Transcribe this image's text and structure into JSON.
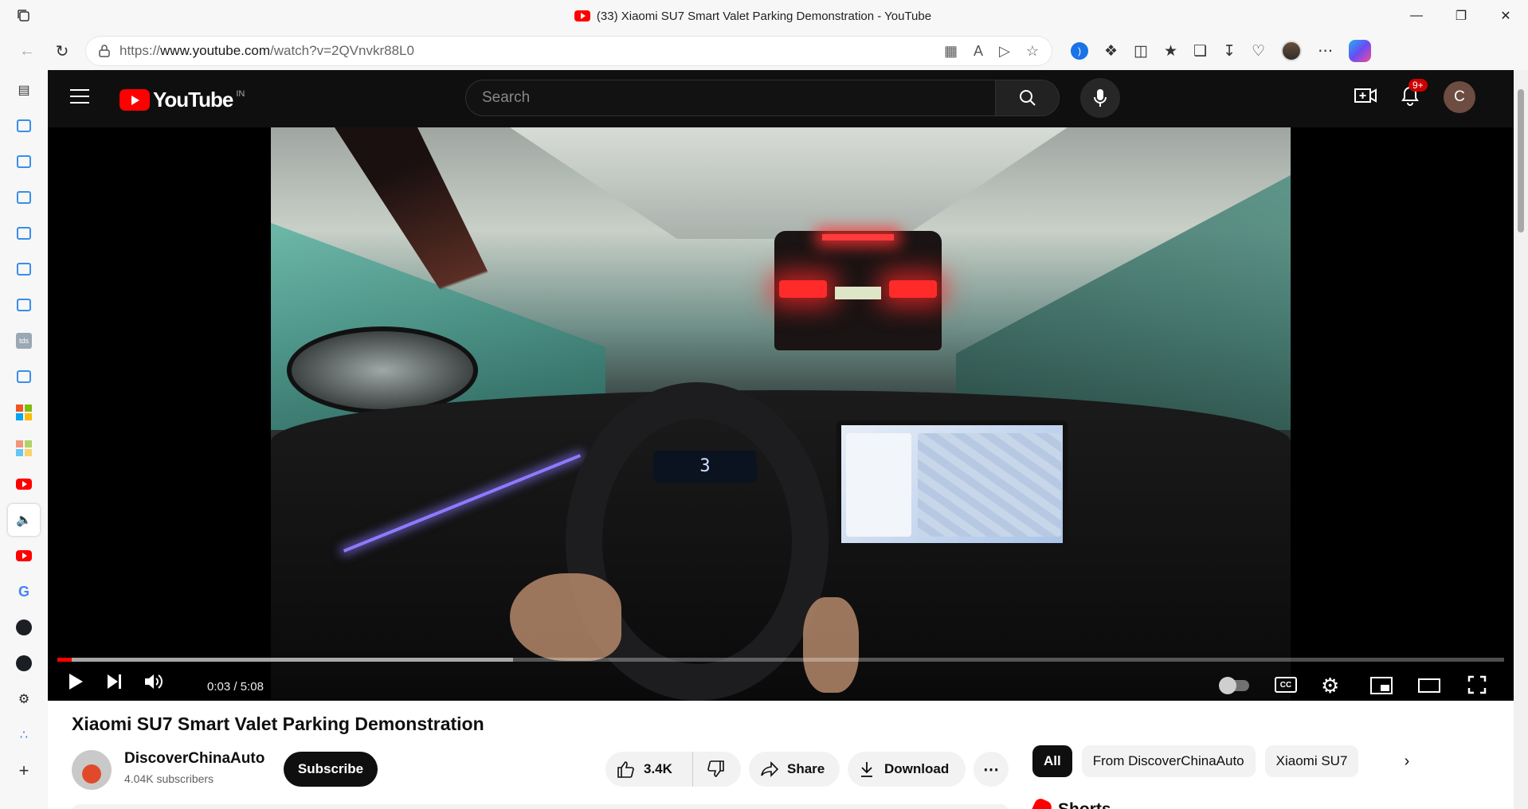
{
  "browser": {
    "tab_title": "(33) Xiaomi SU7 Smart Valet Parking Demonstration - YouTube",
    "url_prefix": "https://",
    "url_host": "www.youtube.com",
    "url_path": "/watch?v=2QVnvkr88L0"
  },
  "header": {
    "logo_text": "YouTube",
    "country_code": "IN",
    "search_placeholder": "Search",
    "notification_count": "9+",
    "avatar_initial": "C"
  },
  "player": {
    "current_time": "0:03",
    "duration": "5:08",
    "time_separator": " / ",
    "progress_fraction": 0.0098,
    "buffer_fraction": 0.315,
    "cc_label": "CC",
    "dashboard_gear": "3"
  },
  "video": {
    "title": "Xiaomi SU7 Smart Valet Parking Demonstration",
    "channel_name": "DiscoverChinaAuto",
    "subscribers": "4.04K subscribers",
    "subscribe_label": "Subscribe",
    "like_count": "3.4K",
    "share_label": "Share",
    "download_label": "Download",
    "more_label": "⋯"
  },
  "recommendations": {
    "chips": [
      "All",
      "From DiscoverChinaAuto",
      "Xiaomi SU7"
    ],
    "shorts_heading": "Shorts"
  },
  "colors": {
    "accent": "#ff0000",
    "header_bg": "#0f0f0f"
  }
}
